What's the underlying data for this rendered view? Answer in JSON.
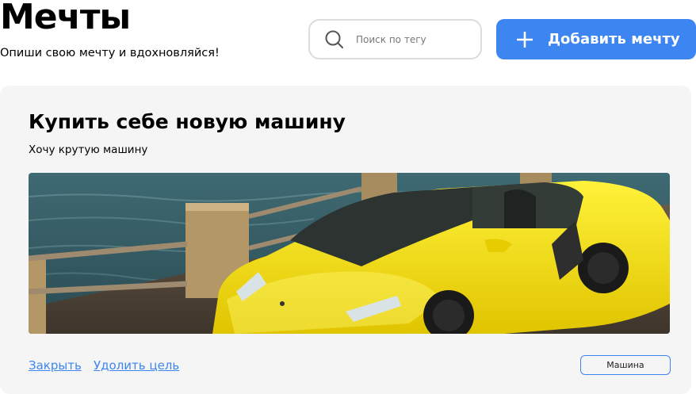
{
  "header": {
    "title": "Мечты",
    "subtitle": "Опиши свою мечту и вдохновляйся!"
  },
  "search": {
    "placeholder": "Поиск по тегу",
    "value": "",
    "icon": "search-icon"
  },
  "add_button": {
    "label": "Добавить мечту",
    "icon": "plus-icon"
  },
  "dreams": [
    {
      "title": "Купить себе новую машину",
      "description": "Хочу крутую машину",
      "image": "yellow sports convertible by the sea",
      "actions": {
        "close_label": "Закрыть",
        "delete_label": "Удолить цель"
      },
      "tag": "Машина"
    }
  ],
  "colors": {
    "accent": "#3d86f1",
    "card_background": "#f5f5f5",
    "input_border": "#dcdcdc"
  }
}
